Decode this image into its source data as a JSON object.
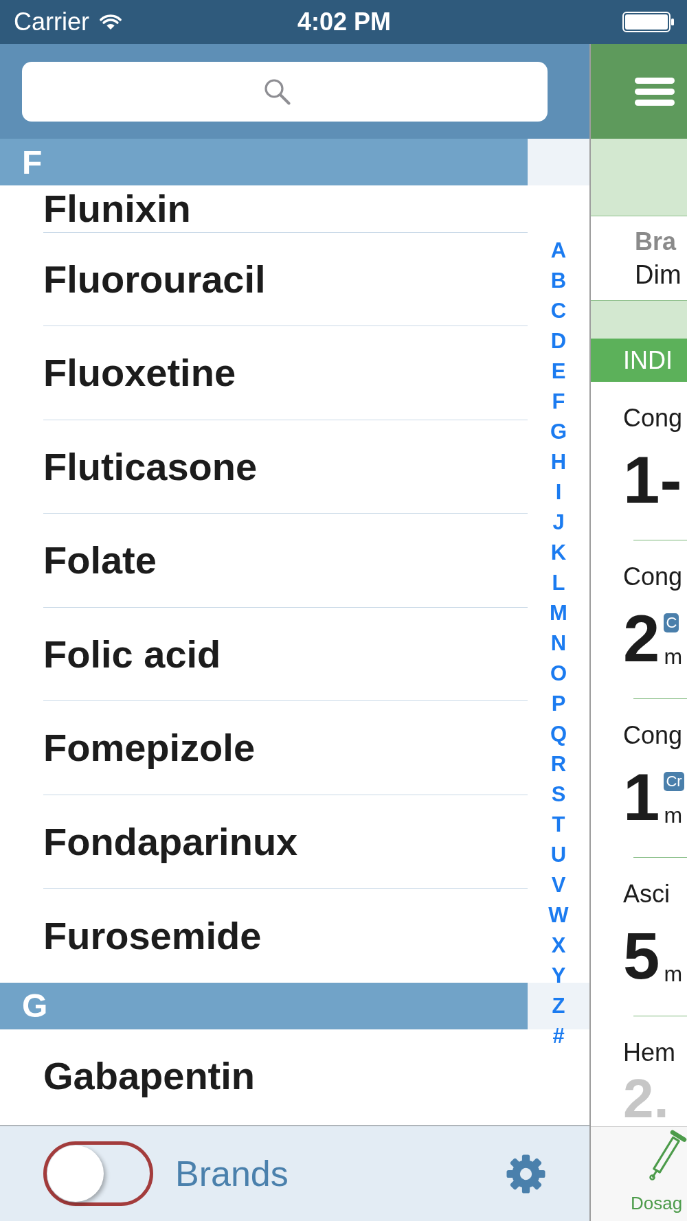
{
  "status_bar": {
    "carrier": "Carrier",
    "time": "4:02 PM"
  },
  "drug_list": {
    "sections": [
      {
        "letter": "F",
        "items": [
          "Flunixin",
          "Fluorouracil",
          "Fluoxetine",
          "Fluticasone",
          "Folate",
          "Folic acid",
          "Fomepizole",
          "Fondaparinux",
          "Furosemide"
        ]
      },
      {
        "letter": "G",
        "items": [
          "Gabapentin"
        ]
      }
    ],
    "index": [
      "A",
      "B",
      "C",
      "D",
      "E",
      "F",
      "G",
      "H",
      "I",
      "J",
      "K",
      "L",
      "M",
      "N",
      "O",
      "P",
      "Q",
      "R",
      "S",
      "T",
      "U",
      "V",
      "W",
      "X",
      "Y",
      "Z",
      "#"
    ]
  },
  "bottom_bar": {
    "toggle": {
      "label": "Brands",
      "on": false
    }
  },
  "detail": {
    "brand": {
      "label": "Bra",
      "value": "Dim"
    },
    "section_title": "INDI",
    "entries": [
      {
        "label": "Cong",
        "value": "1-",
        "faded": false
      },
      {
        "label": "Cong",
        "value": "2",
        "badge": "C",
        "unit": "m",
        "faded": false
      },
      {
        "label": "Cong",
        "value": "1",
        "badge": "Cr",
        "unit": "m",
        "faded": false
      },
      {
        "label": "Asci",
        "value": "5",
        "unit": "m",
        "faded": false
      },
      {
        "label": "Hem",
        "value": "2.",
        "faded": true
      }
    ],
    "tabs": [
      {
        "label": "Dosag",
        "selected": true
      }
    ]
  }
}
